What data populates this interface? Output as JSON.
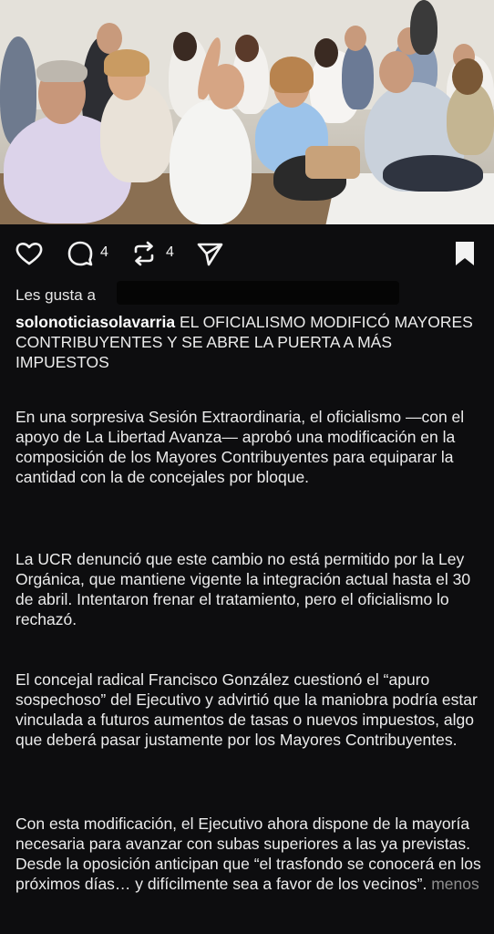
{
  "post": {
    "counts": {
      "comments": "4",
      "reposts": "4"
    },
    "likes_prefix": "Les gusta a",
    "username": "solonoticiasolavarria",
    "headline": "EL OFICIALISMO MODIFICÓ MAYORES CONTRIBUYENTES Y SE ABRE LA PUERTA A MÁS IMPUESTOS",
    "paragraphs": [
      "En una sorpresiva Sesión Extraordinaria, el oficialismo —con el apoyo de La Libertad Avanza— aprobó una modificación en la composición de los Mayores Contribuyentes para equiparar la cantidad con la de concejales por bloque.",
      "La UCR denunció que este cambio no está permitido por la Ley Orgánica, que mantiene vigente la integración actual hasta el 30 de abril. Intentaron frenar el tratamiento, pero el oficialismo lo rechazó.",
      "El concejal radical Francisco González cuestionó el “apuro sospechoso” del Ejecutivo y advirtió que la maniobra podría estar vinculada a futuros aumentos de tasas o nuevos impuestos, algo que deberá pasar justamente por los Mayores Contribuyentes.",
      "Con esta modificación, el Ejecutivo ahora dispone de la mayoría necesaria para avanzar con subas superiores a las ya previstas. Desde la oposición anticipan que “el trasfondo se conocerá en los próximos días… y difícilmente sea a favor de los vecinos”."
    ],
    "more_label": "menos"
  },
  "colors": {
    "background": "#0d0d0f",
    "text": "#ececec",
    "muted": "#8e8e8e"
  },
  "icons": [
    "heart-icon",
    "comment-icon",
    "repost-icon",
    "share-icon",
    "bookmark-icon"
  ]
}
